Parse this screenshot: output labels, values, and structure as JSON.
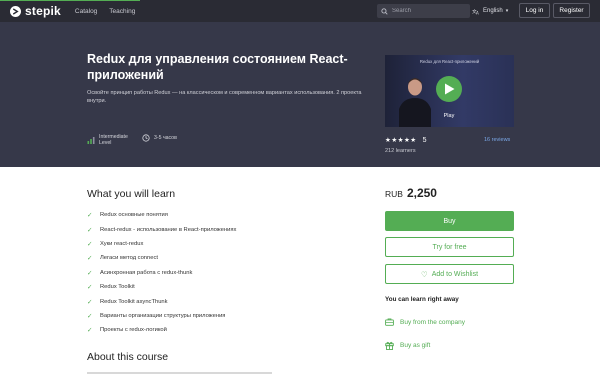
{
  "brand": {
    "name": "stepik",
    "accent": "#54ad54",
    "nav_bg": "#2a2b34",
    "hero_bg": "#363849"
  },
  "nav": {
    "links": [
      "Catalog",
      "Teaching"
    ],
    "search_placeholder": "Search",
    "language": "English",
    "login": "Log in",
    "register": "Register"
  },
  "course": {
    "title": "Redux для управления состоянием React-приложений",
    "description": "Освойте принцип работы Redux — на классическом и современном вариантах использования. 2 проекта внутри.",
    "level_line1": "Intermediate",
    "level_line2": "Level",
    "hours": "3-5 часов",
    "video_title": "Redux для React-приложений",
    "play_label": "Play",
    "stars": "★★★★★",
    "rating": "5",
    "reviews": "16 reviews",
    "learners": "212 learners"
  },
  "learn": {
    "title": "What you will learn",
    "items": [
      "Redux основные понятия",
      "React-redux - использование в React-приложениях",
      "Хуки react-redux",
      "Легаси метод connect",
      "Асинхронная работа с redux-thunk",
      "Redux Toolkit",
      "Redux Toolkit asyncThunk",
      "Варианты организации структуры приложения",
      "Проекты с redux-логикой"
    ]
  },
  "about": {
    "title": "About this course"
  },
  "purchase": {
    "currency": "RUB",
    "price": "2,250",
    "buy": "Buy",
    "try": "Try for free",
    "wishlist": "Add to Wishlist",
    "learn_away": "You can learn right away",
    "buy_company": "Buy from the company",
    "buy_gift": "Buy as gift"
  }
}
